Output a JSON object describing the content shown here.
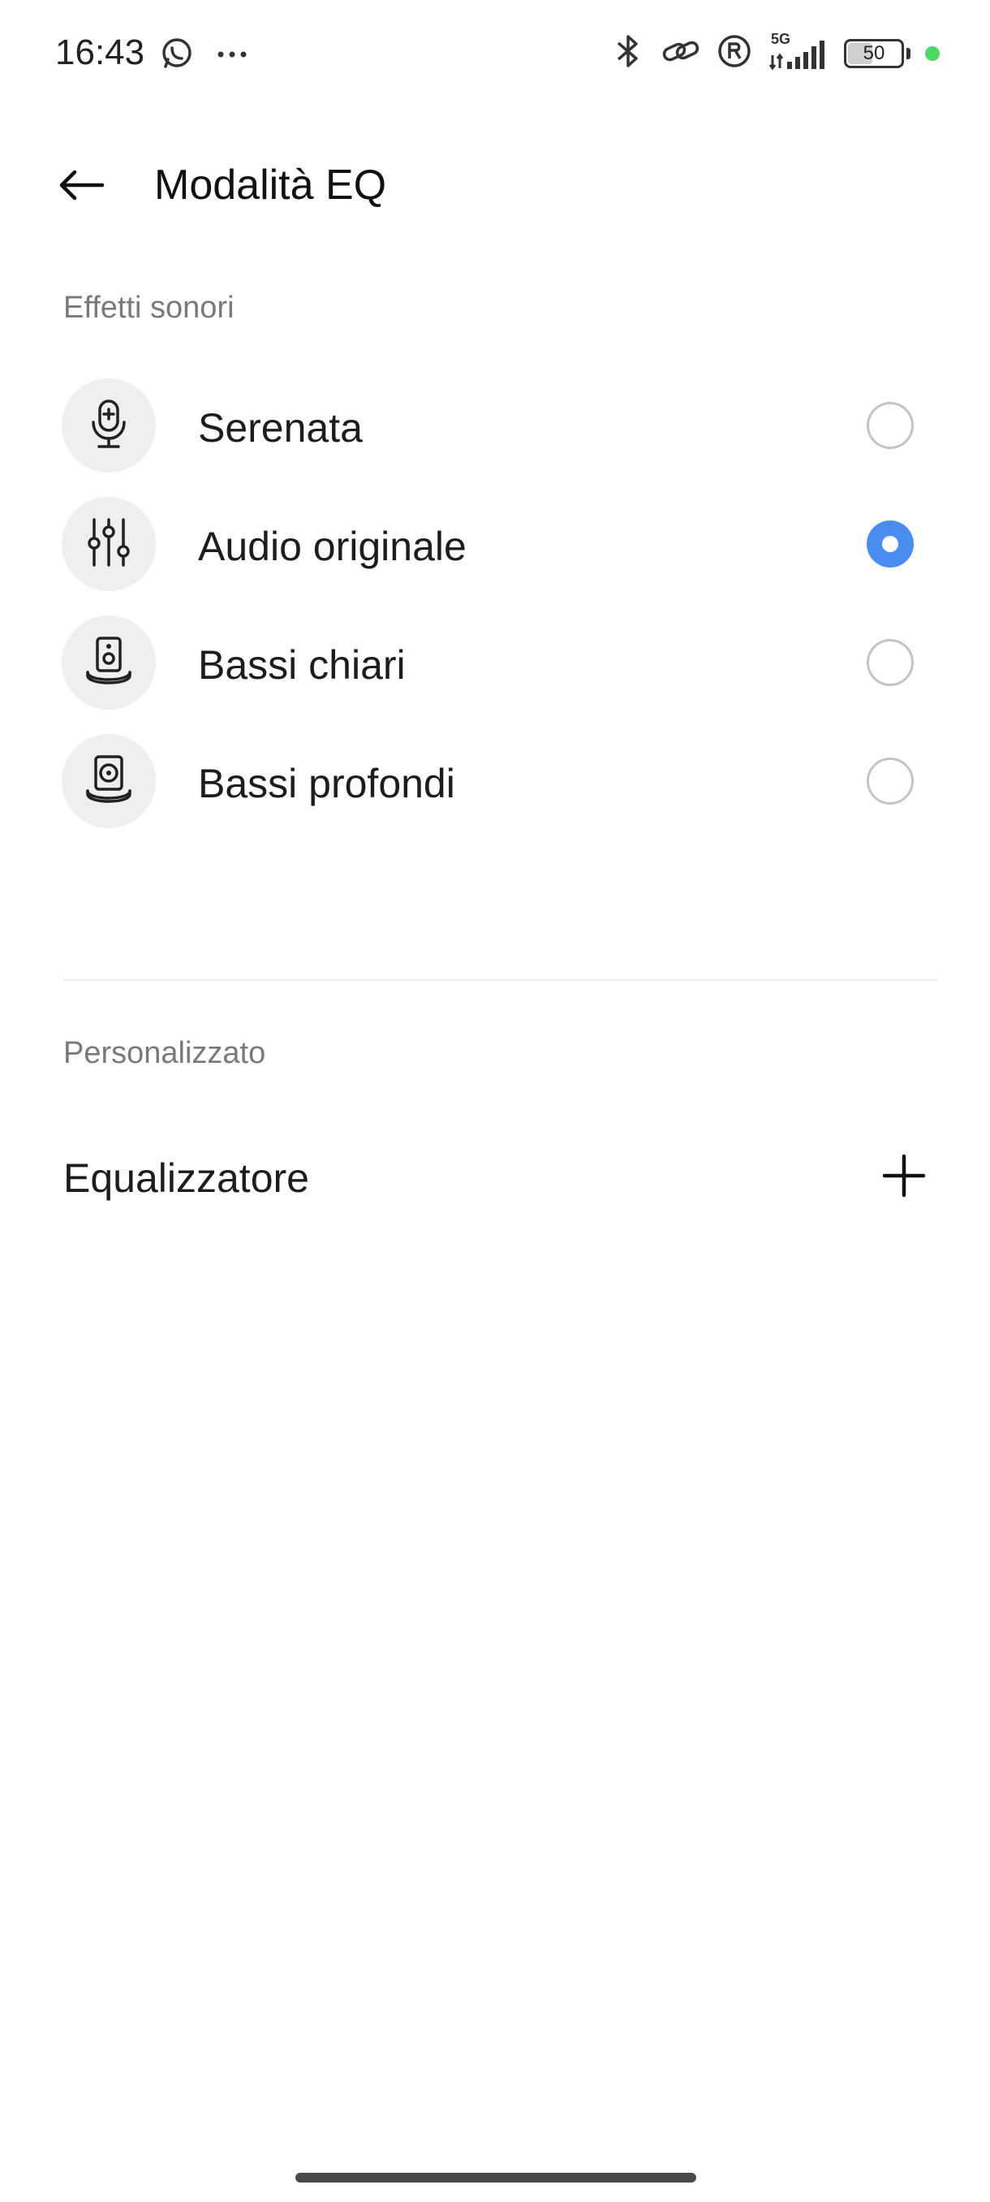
{
  "status_bar": {
    "time": "16:43",
    "network": "5G",
    "battery_level": "50",
    "battery_fraction": 0.5,
    "icons": [
      "whatsapp-icon",
      "more-dots-icon",
      "bluetooth-icon",
      "link-icon",
      "registered-icon",
      "signal-icon",
      "battery-icon",
      "green-dot"
    ]
  },
  "header": {
    "title": "Modalità EQ",
    "back_icon": "arrow-left-icon"
  },
  "sound_effects": {
    "section_label": "Effetti sonori",
    "options": [
      {
        "label": "Serenata",
        "icon": "microphone-icon",
        "selected": false
      },
      {
        "label": "Audio originale",
        "icon": "sliders-icon",
        "selected": true
      },
      {
        "label": "Bassi chiari",
        "icon": "speaker-icon",
        "selected": false
      },
      {
        "label": "Bassi profondi",
        "icon": "speaker-deep-icon",
        "selected": false
      }
    ]
  },
  "custom": {
    "section_label": "Personalizzato",
    "equalizer_label": "Equalizzatore",
    "add_icon": "plus-icon"
  },
  "colors": {
    "accent": "#4a8df0",
    "status_dot": "#4cd964",
    "icon_bg": "#efefef"
  }
}
